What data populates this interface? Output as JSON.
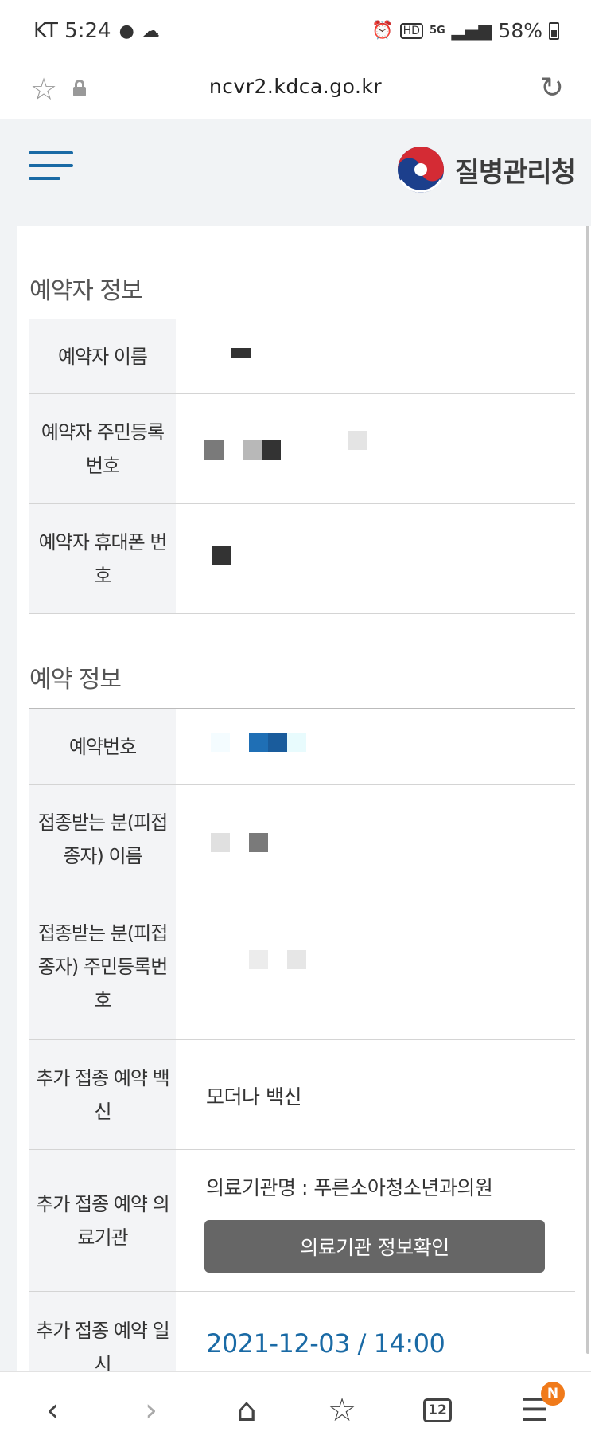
{
  "status_bar": {
    "carrier_time": "KT 5:24",
    "battery": "58%",
    "icons": [
      "chat-bubble-icon",
      "cloud-icon",
      "alarm-icon",
      "hd-icon",
      "5g-icon",
      "signal-icon",
      "battery-icon"
    ]
  },
  "address_bar": {
    "url": "ncvr2.kdca.go.kr"
  },
  "header": {
    "logo_text": "질병관리청"
  },
  "reserver_section": {
    "title": "예약자 정보",
    "rows": [
      {
        "label": "예약자 이름"
      },
      {
        "label": "예약자 주민등록번호"
      },
      {
        "label": "예약자 휴대폰 번호"
      }
    ]
  },
  "reservation_section": {
    "title": "예약 정보",
    "rows": [
      {
        "label": "예약번호"
      },
      {
        "label": "접종받는 분(피접종자) 이름"
      },
      {
        "label": "접종받는 분(피접종자) 주민등록번호"
      },
      {
        "label": "추가 접종 예약 백신",
        "value": "모더나 백신"
      },
      {
        "label": "추가 접종 예약 의료기관",
        "value": "의료기관명 : 푸른소아청소년과의원",
        "button": "의료기관 정보확인"
      },
      {
        "label": "추가 접종 예약 일시",
        "value": "2021-12-03 / 14:00"
      }
    ]
  },
  "bottom_nav": {
    "tabs_count": "12",
    "menu_badge": "N"
  },
  "colors": {
    "accent": "#1a6aa5",
    "label_bg": "#f3f4f6",
    "button_bg": "#666666",
    "badge": "#f07a1a"
  }
}
